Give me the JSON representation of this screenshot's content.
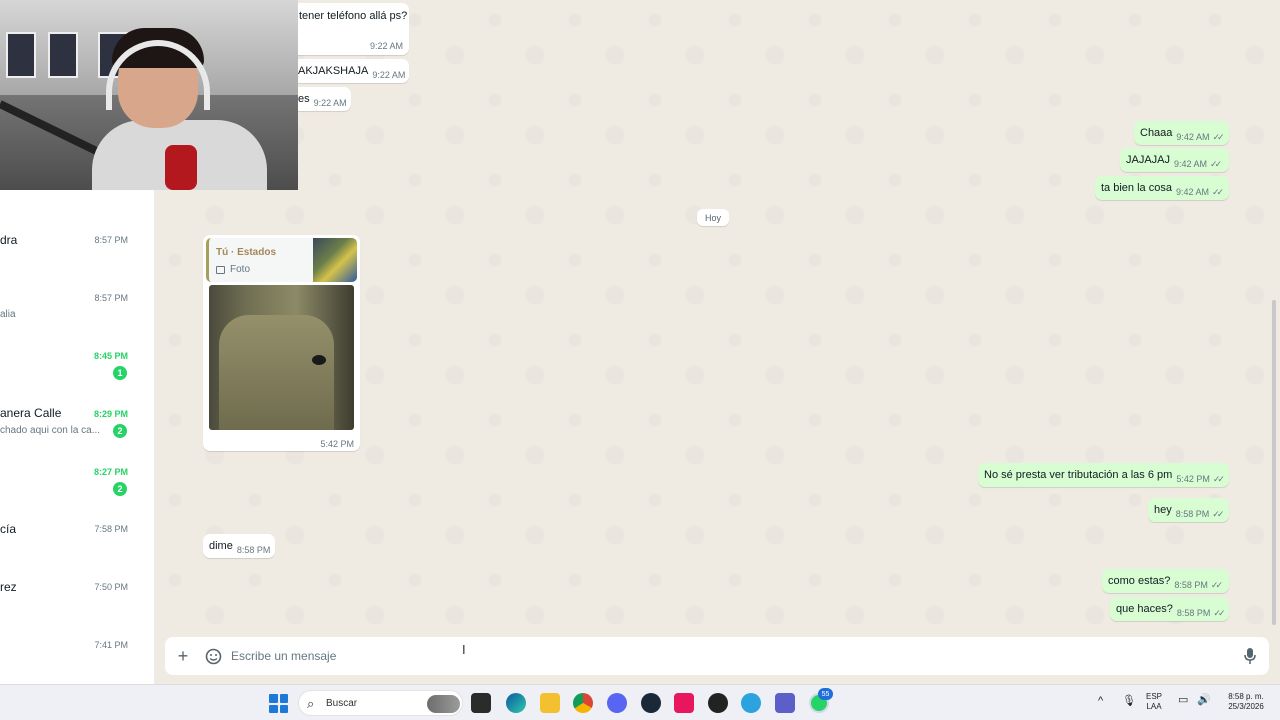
{
  "chat_list": [
    {
      "name": "dra",
      "preview": "",
      "time": "8:57 PM",
      "unread": null
    },
    {
      "name": "",
      "preview": "alia",
      "time": "8:57 PM",
      "unread": null
    },
    {
      "name": "",
      "preview": "",
      "time": "8:45 PM",
      "unread": "1"
    },
    {
      "name": "anera Calle",
      "preview": "chado aqui con la ca...",
      "time": "8:29 PM",
      "unread": "2"
    },
    {
      "name": "",
      "preview": "",
      "time": "8:27 PM",
      "unread": "2"
    },
    {
      "name": "cía",
      "preview": "",
      "time": "7:58 PM",
      "unread": null
    },
    {
      "name": "rez",
      "preview": "",
      "time": "7:50 PM",
      "unread": null
    },
    {
      "name": "",
      "preview": "",
      "time": "7:41 PM",
      "unread": null
    }
  ],
  "messages": {
    "in_1": {
      "text": "tener teléfono allá ps?",
      "time": "9:22 AM"
    },
    "in_2": {
      "text": "AKJAKSHAJA",
      "time": "9:22 AM"
    },
    "in_3": {
      "text": "es",
      "time": "9:22 AM"
    },
    "in_4": {
      "time": "9:22 AM"
    },
    "out_1": {
      "text": "Chaaa",
      "time": "9:42 AM"
    },
    "out_2": {
      "text": "JAJAJAJ",
      "time": "9:42 AM"
    },
    "out_3": {
      "text": "ta bien la cosa",
      "time": "9:42 AM"
    },
    "day_separator": "Hoy",
    "photo": {
      "quote_title": "Tú · Estados",
      "quote_sub": "Foto",
      "time": "5:42 PM"
    },
    "out_4": {
      "text": "No sé presta ver tributación a las 6 pm",
      "time": "5:42 PM"
    },
    "out_5": {
      "text": "hey",
      "time": "8:58 PM"
    },
    "in_5": {
      "text": "dime",
      "time": "8:58 PM"
    },
    "out_6": {
      "text": "como estas?",
      "time": "8:58 PM"
    },
    "out_7": {
      "text": "que haces?",
      "time": "8:58 PM"
    }
  },
  "composer": {
    "placeholder": "Escribe un mensaje"
  },
  "taskbar": {
    "search_label": "Buscar",
    "whatsapp_badge": "55",
    "language_top": "ESP",
    "language_bottom": "LAA",
    "time": "8:58 p. m.",
    "date": "25/3/2026"
  },
  "colors": {
    "outgoing_bubble": "#d9fdd3",
    "unread_green": "#25d366",
    "chat_bg": "#efeae2"
  }
}
